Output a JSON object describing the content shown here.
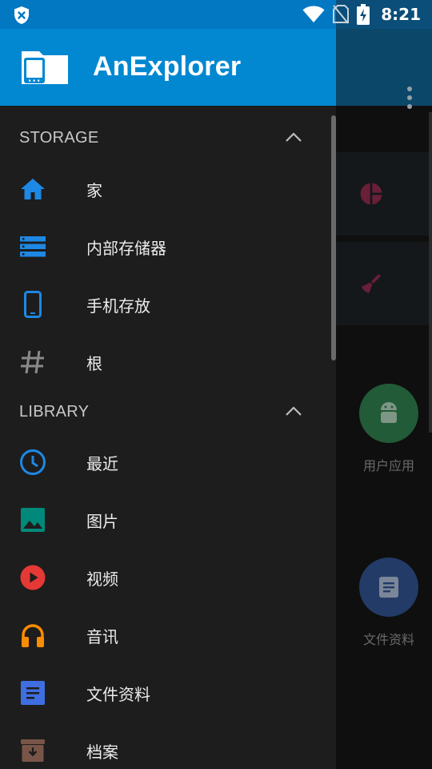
{
  "status_bar": {
    "time": "8:21",
    "icons": [
      "vpn-shield-icon",
      "wifi-icon",
      "no-sim-icon",
      "battery-charging-icon"
    ]
  },
  "drawer": {
    "title": "AnExplorer",
    "logo": "folder-phone-icon",
    "sections": [
      {
        "header": "STORAGE",
        "expanded": true,
        "items": [
          {
            "label": "家",
            "icon": "home-icon",
            "color": "#1e88e5"
          },
          {
            "label": "内部存储器",
            "icon": "storage-icon",
            "color": "#1e88e5"
          },
          {
            "label": "手机存放",
            "icon": "phone-icon",
            "color": "#1e88e5"
          },
          {
            "label": "根",
            "icon": "hash-icon",
            "color": "#8a8a8a"
          }
        ]
      },
      {
        "header": "LIBRARY",
        "expanded": true,
        "items": [
          {
            "label": "最近",
            "icon": "clock-icon",
            "color": "#1e88e5"
          },
          {
            "label": "图片",
            "icon": "image-icon",
            "color": "#00897b"
          },
          {
            "label": "视频",
            "icon": "video-icon",
            "color": "#e53935"
          },
          {
            "label": "音讯",
            "icon": "headphones-icon",
            "color": "#fb8c00"
          },
          {
            "label": "文件资料",
            "icon": "document-icon",
            "color": "#3f6ee0"
          },
          {
            "label": "档案",
            "icon": "archive-icon",
            "color": "#795548"
          }
        ]
      }
    ]
  },
  "background": {
    "apps_label": "用户应用",
    "docs_label": "文件资料"
  }
}
